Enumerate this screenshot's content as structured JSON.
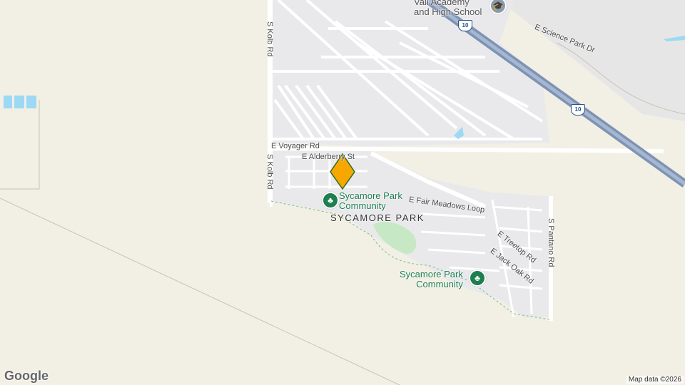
{
  "map": {
    "labels": {
      "school": [
        "Vail Academy",
        "and High School"
      ],
      "interstate": "10",
      "science_park": "E Science Park Dr",
      "kolb_north": "S Kolb Rd",
      "kolb_south": "S Kolb Rd",
      "voyager": "E Voyager Rd",
      "alderberry": "E Alderberry St",
      "park_poi_1": [
        "Sycamore Park",
        "Community"
      ],
      "area": "SYCAMORE PARK",
      "fair_meadows": "E Fair Meadows Loop",
      "treetop": "E Treetop Rd",
      "jack_oak": "E Jack Oak Rd",
      "pantano": "S Pantano Rd",
      "park_poi_2": [
        "Sycamore Park",
        "Community"
      ]
    },
    "attribution": "Map data ©2026",
    "logo": "Google",
    "colors": {
      "land": "#f2efe4",
      "residential": "#e9e9ec",
      "park": "#c7e8c4",
      "water": "#9cd9f4",
      "highway": "#8aa0c0",
      "marker": "#f6a800",
      "poi": "#1e7e4f"
    },
    "icons": {
      "school": "school-icon",
      "park": "tree-icon",
      "marker": "location-marker-icon"
    }
  }
}
